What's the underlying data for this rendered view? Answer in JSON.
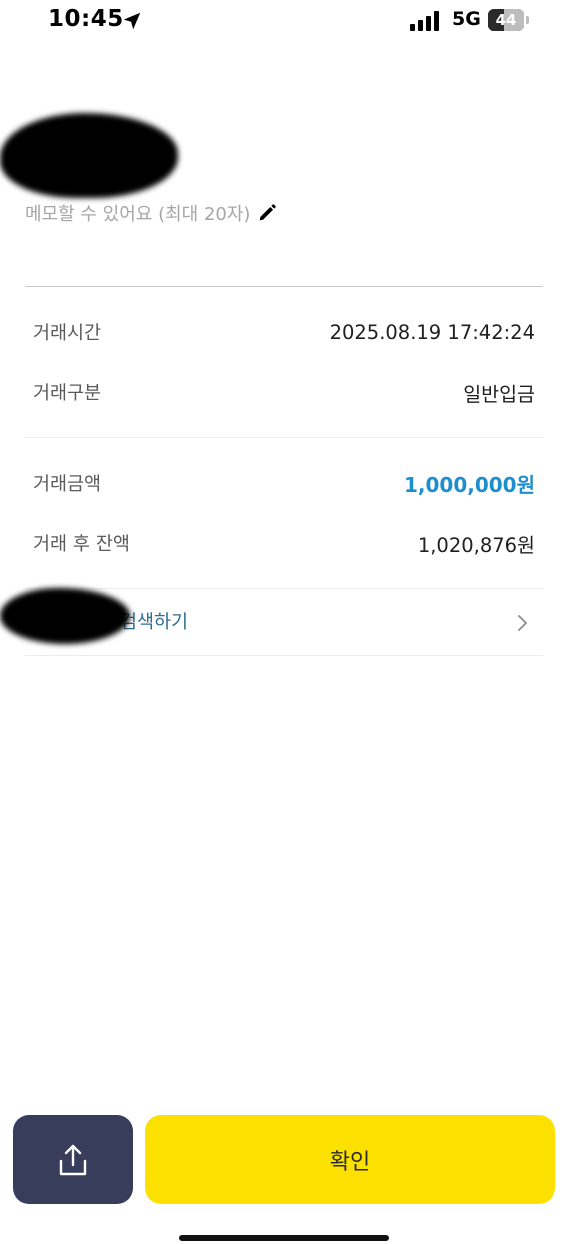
{
  "status_bar": {
    "time": "10:45",
    "network": "5G",
    "battery": "44",
    "battery_level": 0.44,
    "icons": [
      "location-arrow-icon",
      "signal-bars-icon",
      "battery-icon"
    ]
  },
  "memo": {
    "placeholder": "메모할 수 있어요 (최대 20자)",
    "icon": "pencil-icon"
  },
  "details": {
    "time": {
      "label": "거래시간",
      "value": "2025.08.19 17:42:24"
    },
    "type": {
      "label": "거래구분",
      "value": "일반입금"
    }
  },
  "amounts": {
    "amount": {
      "label": "거래금액",
      "value": "1,000,000원"
    },
    "balance": {
      "label": "거래 후 잔액",
      "value": "1,020,876원"
    }
  },
  "search": {
    "label": "검색하기",
    "icon": "chevron-right-icon"
  },
  "actions": {
    "share_icon": "share-icon",
    "confirm_label": "확인"
  },
  "colors": {
    "amount": "#1d8fcf",
    "confirm_bg": "#fce000",
    "share_bg": "#383d5c",
    "link": "#2c6d93"
  }
}
